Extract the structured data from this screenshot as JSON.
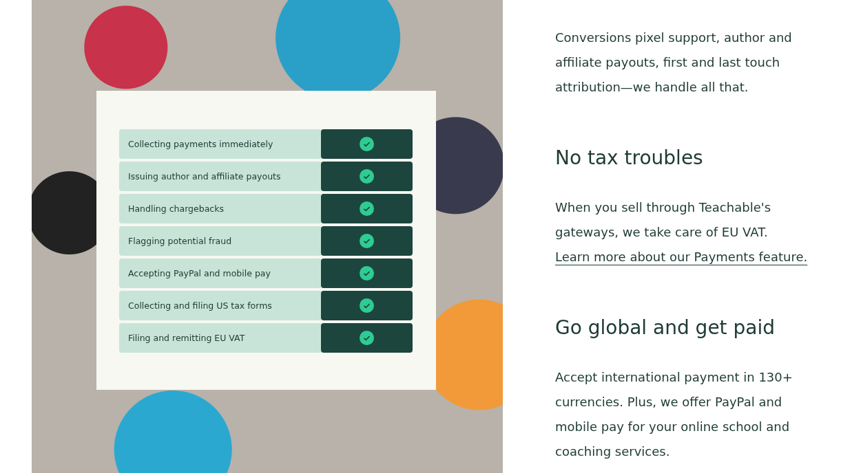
{
  "feature_table": {
    "rows": [
      {
        "label": "Collecting payments immediately",
        "checked": true
      },
      {
        "label": "Issuing author and affiliate payouts",
        "checked": true
      },
      {
        "label": "Handling chargebacks",
        "checked": true
      },
      {
        "label": "Flagging potential fraud",
        "checked": true
      },
      {
        "label": "Accepting PayPal and mobile pay",
        "checked": true
      },
      {
        "label": "Collecting and filing US tax forms",
        "checked": true
      },
      {
        "label": "Filing and remitting EU VAT",
        "checked": true
      }
    ]
  },
  "sections": [
    {
      "body": "Conversions pixel support, author and affiliate payouts, first and last touch attribution—we handle all that."
    },
    {
      "heading": "No tax troubles",
      "body": "When you sell through Teachable's gateways, we take care of EU VAT.",
      "link": "Learn more about our Payments feature."
    },
    {
      "heading": "Go global and get paid",
      "body": "Accept international payment in 130+ currencies. Plus, we offer PayPal and mobile pay for your online school and coaching services."
    }
  ]
}
